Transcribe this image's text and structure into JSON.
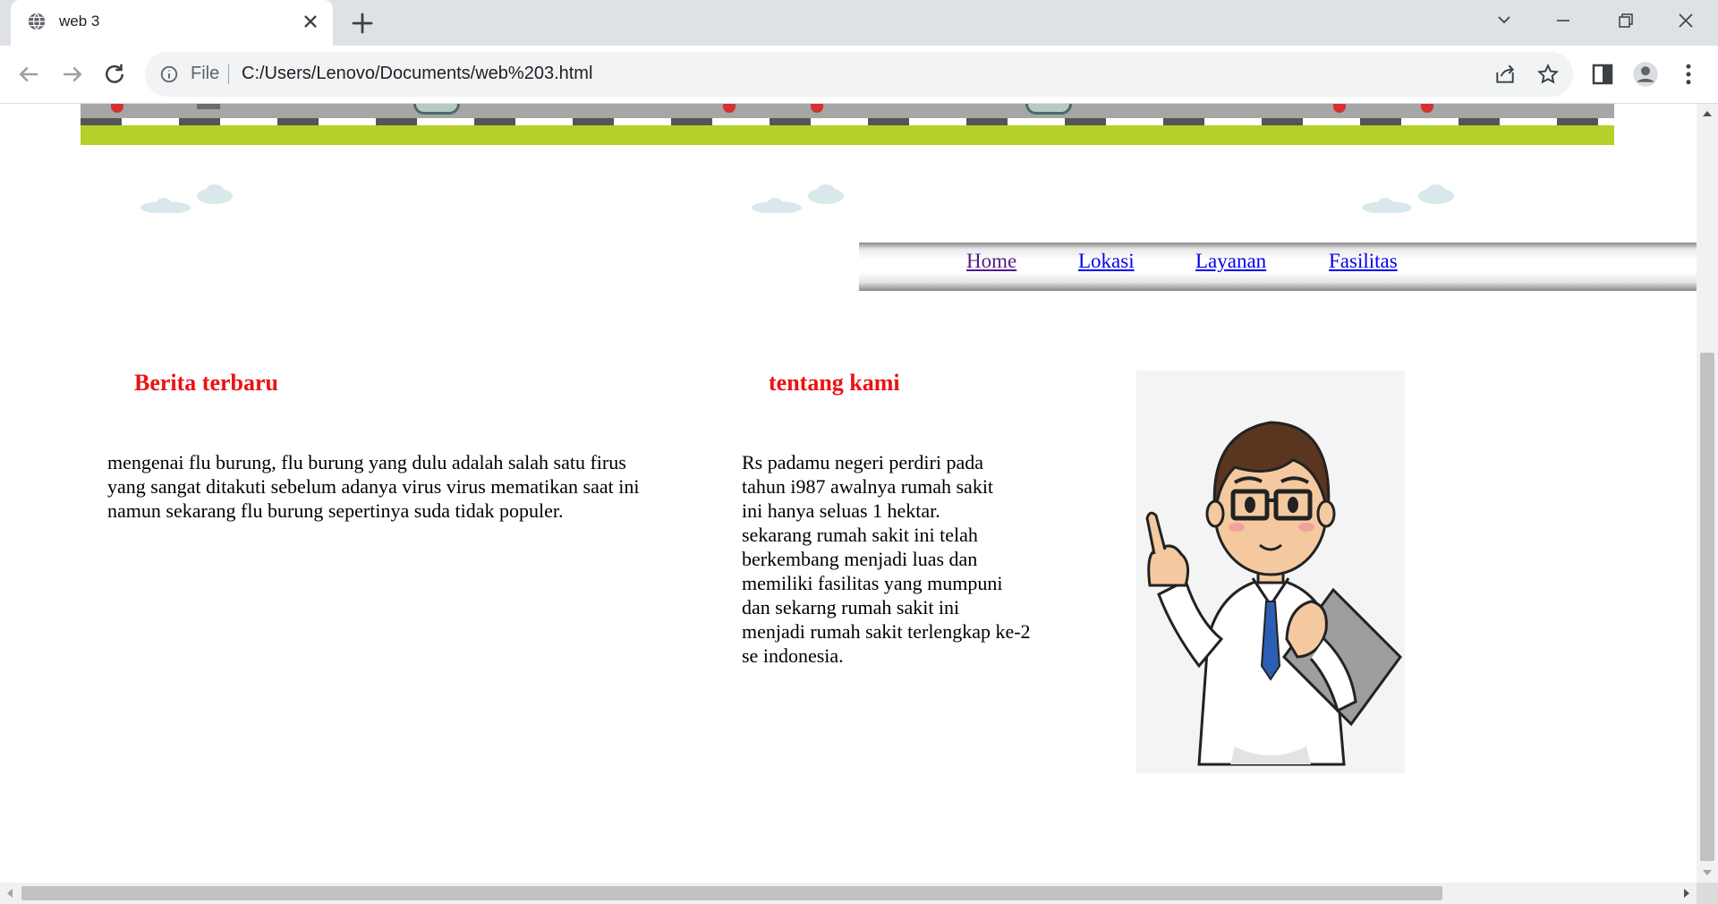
{
  "browser": {
    "tab_title": "web 3",
    "omnibox_label": "File",
    "url": "C:/Users/Lenovo/Documents/web%203.html"
  },
  "nav": {
    "items": [
      {
        "label": "Home"
      },
      {
        "label": "Lokasi"
      },
      {
        "label": "Layanan"
      },
      {
        "label": "Fasilitas"
      }
    ]
  },
  "news": {
    "heading": "Berita terbaru",
    "lines": [
      "mengenai flu burung, flu burung yang dulu adalah salah satu firus",
      "yang sangat ditakuti sebelum adanya virus virus mematikan saat ini",
      "namun sekarang flu burung sepertinya suda tidak populer."
    ]
  },
  "about": {
    "heading": "tentang kami",
    "lines": [
      "Rs padamu negeri perdiri pada",
      "tahun i987 awalnya rumah sakit",
      "ini hanya seluas 1 hektar.",
      "sekarang rumah sakit ini telah",
      "berkembang menjadi luas dan",
      "memiliki fasilitas yang mumpuni",
      "dan sekarng rumah sakit ini",
      "menjadi rumah sakit terlengkap ke-2",
      "se indonesia."
    ]
  },
  "colors": {
    "heading": "#ee1111",
    "link": "#0000ee",
    "link_visited": "#551a8b",
    "grass": "#b5cf2b"
  },
  "icons": {
    "tab_favicon": "globe-icon",
    "tab_close": "close-icon",
    "new_tab": "plus-icon",
    "back": "arrow-left-icon",
    "forward": "arrow-right-icon",
    "reload": "reload-icon",
    "site_info": "info-icon",
    "share": "share-icon",
    "bookmark": "star-icon",
    "side_panel": "side-panel-icon",
    "profile": "profile-icon",
    "menu": "kebab-menu-icon",
    "doctor_image": "doctor-illustration"
  },
  "scroll": {
    "vertical_position": 0.33,
    "horizontal_position": 0.0
  }
}
